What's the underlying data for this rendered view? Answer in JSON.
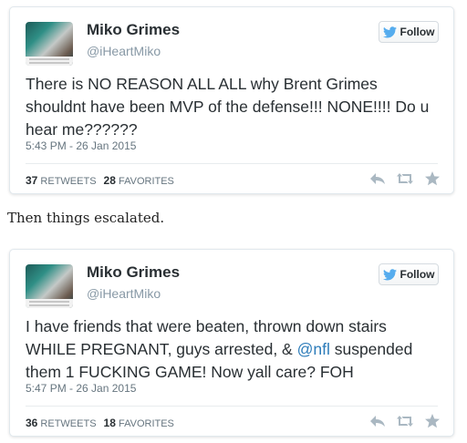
{
  "tweets": [
    {
      "user_name": "Miko Grimes",
      "handle": "@iHeartMiko",
      "follow_label": "Follow",
      "text_parts": [
        "There is NO REASON ALL ALL why Brent Grimes shouldnt have been MVP of the defense!!! NONE!!!! Do u hear me??????"
      ],
      "timestamp": "5:43 PM - 26 Jan 2015",
      "retweets": "37",
      "retweets_label": "RETWEETS",
      "favorites": "28",
      "favorites_label": "FAVORITES"
    },
    {
      "user_name": "Miko Grimes",
      "handle": "@iHeartMiko",
      "follow_label": "Follow",
      "text_parts": [
        "I have friends that were beaten, thrown down stairs WHILE PREGNANT, guys arrested, & ",
        "@nfl",
        "  suspended them 1 FUCKING GAME! Now yall care? FOH"
      ],
      "timestamp": "5:47 PM - 26 Jan 2015",
      "retweets": "36",
      "retweets_label": "RETWEETS",
      "favorites": "18",
      "favorites_label": "FAVORITES"
    }
  ],
  "interstitial_text": "Then things escalated.",
  "colors": {
    "twitter_blue": "#55acee",
    "mention": "#2b7bb9",
    "muted_text": "#8899a6",
    "action_icons": "#aab8c2"
  },
  "icons": [
    "twitter-bird-icon",
    "reply-icon",
    "retweet-icon",
    "favorite-star-icon"
  ]
}
